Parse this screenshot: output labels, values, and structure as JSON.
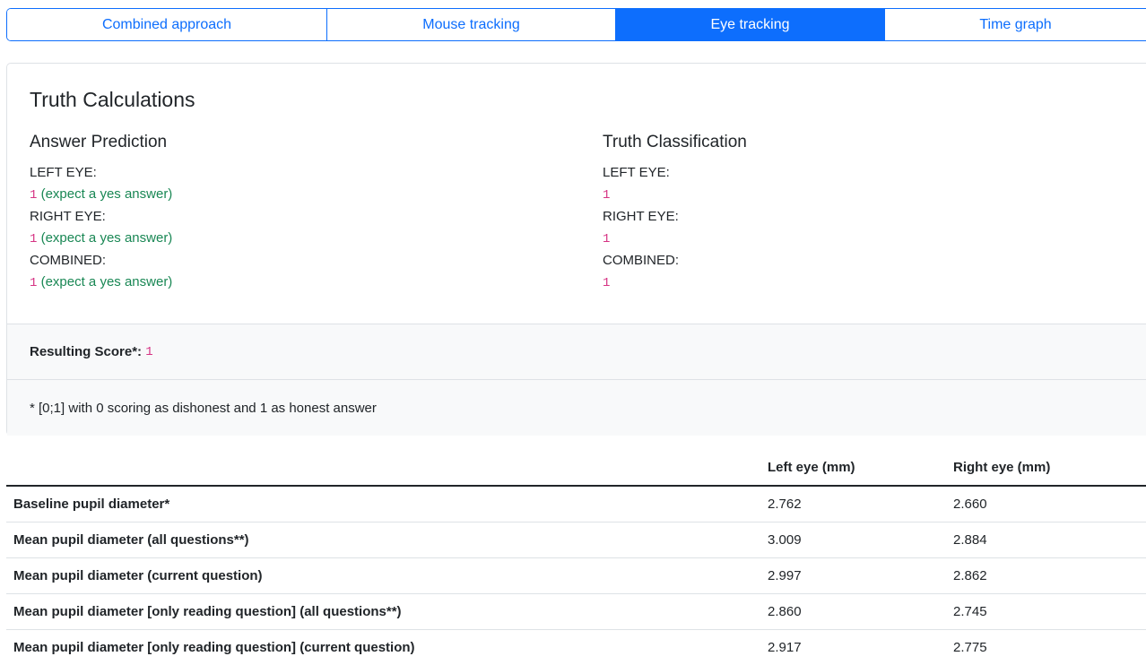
{
  "tabs": [
    {
      "label": "Combined approach",
      "active": false
    },
    {
      "label": "Mouse tracking",
      "active": false
    },
    {
      "label": "Eye tracking",
      "active": true
    },
    {
      "label": "Time graph",
      "active": false
    }
  ],
  "card": {
    "title": "Truth Calculations",
    "answer_prediction": {
      "heading": "Answer Prediction",
      "left_label": "LEFT EYE:",
      "left_value": "1",
      "left_note": "(expect a yes answer)",
      "right_label": "RIGHT EYE:",
      "right_value": "1",
      "right_note": "(expect a yes answer)",
      "combined_label": "COMBINED:",
      "combined_value": "1",
      "combined_note": "(expect a yes answer)"
    },
    "truth_classification": {
      "heading": "Truth Classification",
      "left_label": "LEFT EYE:",
      "left_value": "1",
      "right_label": "RIGHT EYE:",
      "right_value": "1",
      "combined_label": "COMBINED:",
      "combined_value": "1"
    },
    "score_label": "Resulting Score*:",
    "score_value": "1",
    "footnote": "* [0;1] with 0 scoring as dishonest and 1 as honest answer"
  },
  "table": {
    "headers": [
      "",
      "Left eye (mm)",
      "Right eye (mm)"
    ],
    "rows": [
      {
        "label": "Baseline pupil diameter*",
        "left": "2.762",
        "right": "2.660"
      },
      {
        "label": "Mean pupil diameter (all questions**)",
        "left": "3.009",
        "right": "2.884"
      },
      {
        "label": "Mean pupil diameter (current question)",
        "left": "2.997",
        "right": "2.862"
      },
      {
        "label": "Mean pupil diameter [only reading question] (all questions**)",
        "left": "2.860",
        "right": "2.745"
      },
      {
        "label": "Mean pupil diameter [only reading question] (current question)",
        "left": "2.917",
        "right": "2.775"
      }
    ]
  }
}
